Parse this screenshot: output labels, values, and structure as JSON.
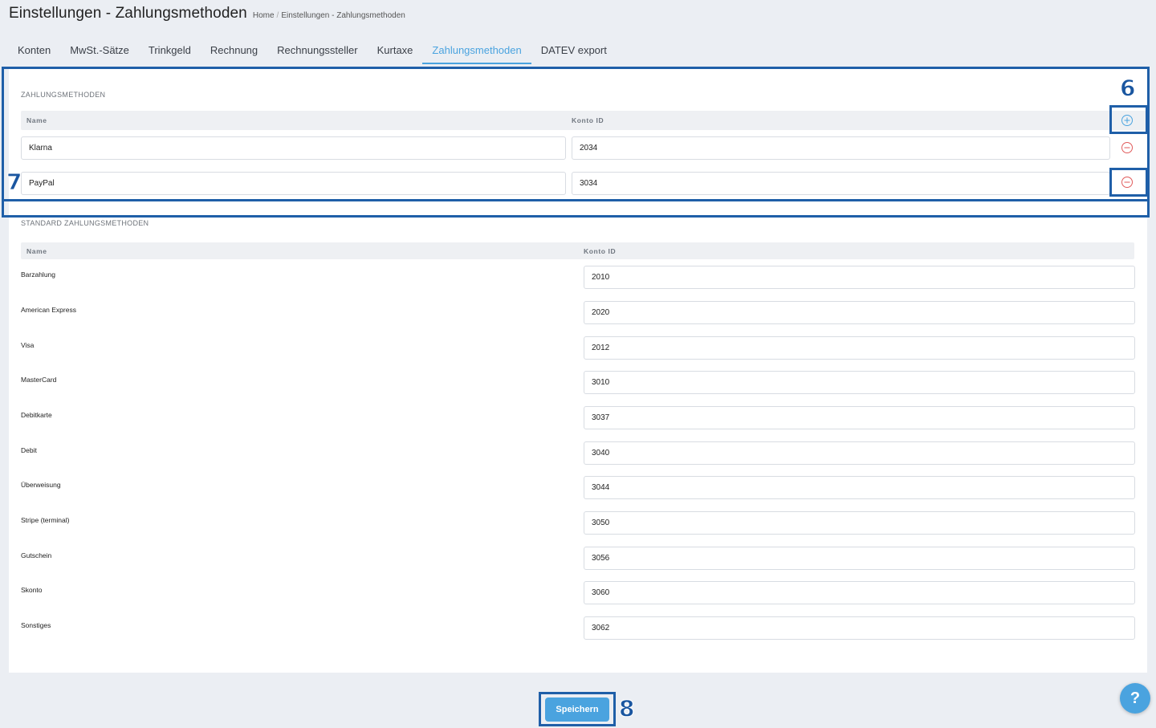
{
  "header": {
    "title": "Einstellungen - Zahlungsmethoden",
    "breadcrumb": [
      "Home",
      "Einstellungen - Zahlungsmethoden"
    ]
  },
  "tabs": [
    {
      "label": "Konten",
      "active": false
    },
    {
      "label": "MwSt.-Sätze",
      "active": false
    },
    {
      "label": "Trinkgeld",
      "active": false
    },
    {
      "label": "Rechnung",
      "active": false
    },
    {
      "label": "Rechnungssteller",
      "active": false
    },
    {
      "label": "Kurtaxe",
      "active": false
    },
    {
      "label": "Zahlungsmethoden",
      "active": true
    },
    {
      "label": "DATEV export",
      "active": false
    }
  ],
  "payment_methods": {
    "section_title": "ZAHLUNGSMETHODEN",
    "col_name": "Name",
    "col_account": "Konto ID",
    "rows": [
      {
        "name": "Klarna",
        "account": "2034"
      },
      {
        "name": "PayPal",
        "account": "3034"
      }
    ]
  },
  "standard_methods": {
    "section_title": "STANDARD ZAHLUNGSMETHODEN",
    "col_name": "Name",
    "col_account": "Konto ID",
    "rows": [
      {
        "name": "Barzahlung",
        "account": "2010"
      },
      {
        "name": "American Express",
        "account": "2020"
      },
      {
        "name": "Visa",
        "account": "2012"
      },
      {
        "name": "MasterCard",
        "account": "3010"
      },
      {
        "name": "Debitkarte",
        "account": "3037"
      },
      {
        "name": "Debit",
        "account": "3040"
      },
      {
        "name": "Überweisung",
        "account": "3044"
      },
      {
        "name": "Stripe (terminal)",
        "account": "3050"
      },
      {
        "name": "Gutschein",
        "account": "3056"
      },
      {
        "name": "Skonto",
        "account": "3060"
      },
      {
        "name": "Sonstiges",
        "account": "3062"
      }
    ]
  },
  "actions": {
    "save_label": "Speichern",
    "help_label": "?"
  },
  "annotations": {
    "marker_6": "6",
    "marker_7": "7",
    "marker_8": "8"
  },
  "colors": {
    "accent": "#4aa3df",
    "remove": "#e05a5a",
    "annotation": "#1f5fa8"
  },
  "icons": {
    "add": "plus-circle-icon",
    "remove": "minus-circle-icon"
  }
}
